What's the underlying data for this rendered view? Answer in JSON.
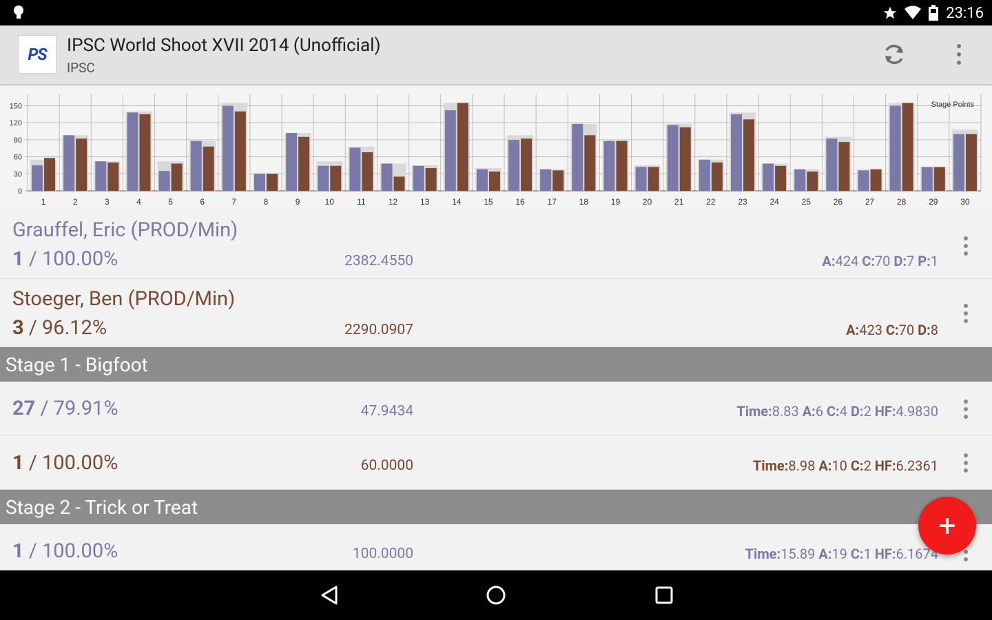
{
  "status_bar": {
    "time": "23:16"
  },
  "app_bar": {
    "logo_text": "PS",
    "title": "IPSC World Shoot XVII 2014 (Unofficial)",
    "subtitle": "IPSC"
  },
  "chart_data": {
    "type": "bar",
    "legend": "Stage Points",
    "ylim": [
      0,
      170
    ],
    "y_ticks": [
      "0",
      "30",
      "60",
      "90",
      "120",
      "150"
    ],
    "categories": [
      "1",
      "2",
      "3",
      "4",
      "5",
      "6",
      "7",
      "8",
      "9",
      "10",
      "11",
      "12",
      "13",
      "14",
      "15",
      "16",
      "17",
      "18",
      "19",
      "20",
      "21",
      "22",
      "23",
      "24",
      "25",
      "26",
      "27",
      "28",
      "29",
      "30"
    ],
    "max_values": [
      55,
      98,
      52,
      140,
      52,
      88,
      155,
      30,
      102,
      52,
      78,
      48,
      45,
      155,
      40,
      98,
      38,
      118,
      88,
      45,
      118,
      55,
      138,
      48,
      38,
      95,
      38,
      155,
      42,
      108
    ],
    "series": [
      {
        "values": [
          45,
          98,
          52,
          138,
          35,
          88,
          150,
          30,
          102,
          44,
          76,
          48,
          44,
          142,
          38,
          90,
          38,
          118,
          88,
          42,
          116,
          55,
          135,
          48,
          38,
          92,
          36,
          150,
          42,
          100
        ]
      },
      {
        "values": [
          58,
          92,
          50,
          135,
          48,
          78,
          140,
          30,
          95,
          44,
          68,
          25,
          40,
          155,
          34,
          92,
          36,
          98,
          88,
          42,
          112,
          50,
          126,
          44,
          34,
          86,
          38,
          155,
          42,
          100
        ]
      }
    ],
    "colors": {
      "series1": "#7a79a8",
      "series2": "#7b4a35",
      "max": "#d9d9d9",
      "grid": "#bdbdbd"
    }
  },
  "shooters": [
    {
      "name": "Grauffel, Eric (PROD/Min)",
      "rank": "1",
      "percent": "100.00%",
      "points": "2382.4550",
      "details": [
        [
          "A:",
          "424"
        ],
        [
          "C:",
          "70"
        ],
        [
          "D:",
          "7"
        ],
        [
          "P:",
          "1"
        ]
      ]
    },
    {
      "name": "Stoeger, Ben (PROD/Min)",
      "rank": "3",
      "percent": "96.12%",
      "points": "2290.0907",
      "details": [
        [
          "A:",
          "423"
        ],
        [
          "C:",
          "70"
        ],
        [
          "D:",
          "8"
        ]
      ]
    }
  ],
  "stages": [
    {
      "title": "Stage 1 - Bigfoot",
      "rows": [
        {
          "rank": "27",
          "percent": "79.91%",
          "points": "47.9434",
          "details": [
            [
              "Time:",
              "8.83"
            ],
            [
              "A:",
              "6"
            ],
            [
              "C:",
              "4"
            ],
            [
              "D:",
              "2"
            ],
            [
              "HF:",
              "4.9830"
            ]
          ]
        },
        {
          "rank": "1",
          "percent": "100.00%",
          "points": "60.0000",
          "details": [
            [
              "Time:",
              "8.98"
            ],
            [
              "A:",
              "10"
            ],
            [
              "C:",
              "2"
            ],
            [
              "HF:",
              "6.2361"
            ]
          ]
        }
      ]
    },
    {
      "title": "Stage 2 - Trick or Treat",
      "rows": [
        {
          "rank": "1",
          "percent": "100.00%",
          "points": "100.0000",
          "details": [
            [
              "Time:",
              "15.89"
            ],
            [
              "A:",
              "19"
            ],
            [
              "C:",
              "1"
            ],
            [
              "HF:",
              "6.1674"
            ]
          ]
        }
      ]
    }
  ],
  "fab": {
    "label": "+"
  }
}
